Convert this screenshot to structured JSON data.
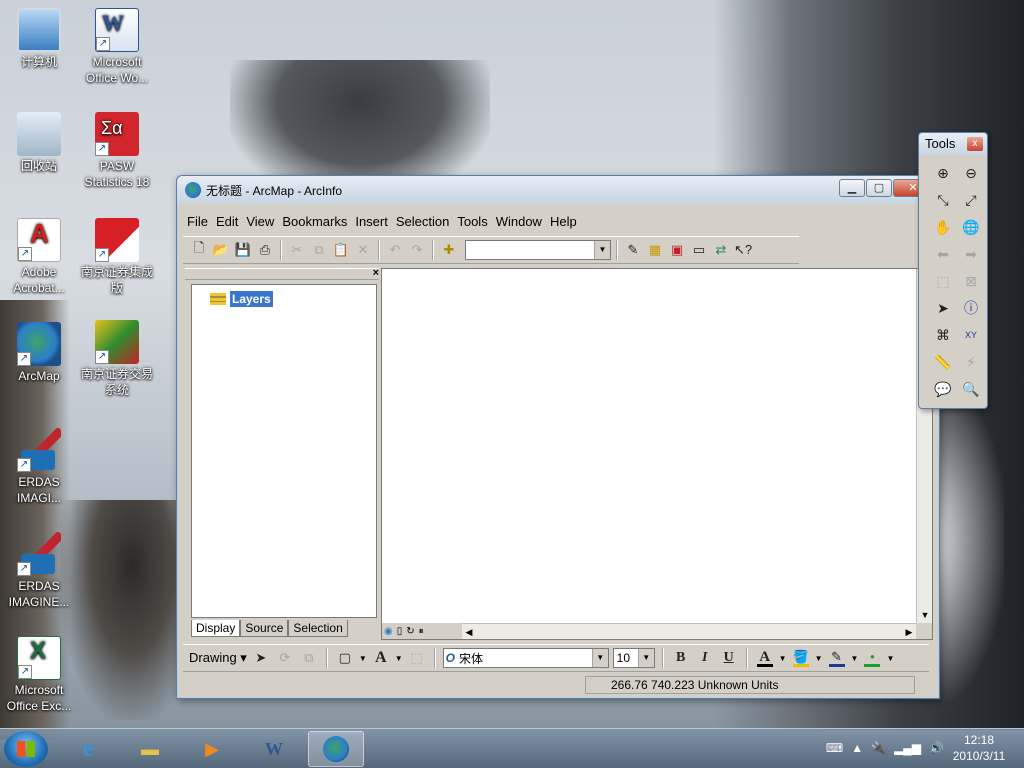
{
  "desktop": {
    "icons": [
      {
        "label": "计算机"
      },
      {
        "label": "Microsoft Office Wo..."
      },
      {
        "label": "回收站"
      },
      {
        "label": "PASW Statistics 18"
      },
      {
        "label": "Adobe Acrobat..."
      },
      {
        "label": "南京证券集成版"
      },
      {
        "label": "ArcMap"
      },
      {
        "label": "南京证券交易系统"
      },
      {
        "label": "ERDAS IMAGI..."
      },
      {
        "label": "ERDAS IMAGINE..."
      },
      {
        "label": "Microsoft Office Exc..."
      }
    ]
  },
  "window": {
    "title": "无标题 - ArcMap - ArcInfo",
    "buttons": {
      "minimize": "▁",
      "maximize": "▢",
      "close": "✕"
    },
    "menu": [
      "File",
      "Edit",
      "View",
      "Bookmarks",
      "Insert",
      "Selection",
      "Tools",
      "Window",
      "Help"
    ],
    "toc": {
      "root_label": "Layers",
      "close": "×",
      "tabs": [
        "Display",
        "Source",
        "Selection"
      ]
    },
    "drawing": {
      "label": "Drawing",
      "font": "宋体",
      "size": "10",
      "bold": "B",
      "italic": "I",
      "underline": "U",
      "font_color": "A"
    },
    "status": {
      "coords": "266.76  740.223 Unknown Units"
    }
  },
  "tools_toolbar": {
    "title": "Tools",
    "close": "x"
  },
  "taskbar": {
    "time": "12:18",
    "date": "2010/3/11"
  }
}
